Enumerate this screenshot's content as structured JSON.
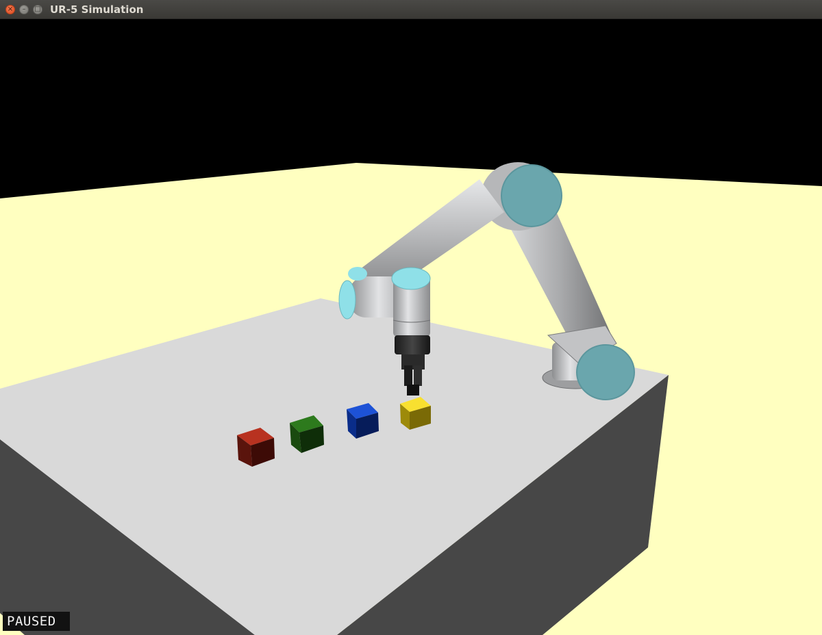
{
  "window": {
    "title": "UR-5 Simulation",
    "buttons": {
      "close": "×",
      "minimize": "–",
      "maximize": "□"
    }
  },
  "viewport": {
    "status_label": "PAUSED"
  },
  "scene": {
    "robot": "UR-5",
    "blocks": [
      {
        "name": "red-block",
        "color": "#8a1e12"
      },
      {
        "name": "green-block",
        "color": "#1c5a12"
      },
      {
        "name": "blue-block",
        "color": "#0a3cb4"
      },
      {
        "name": "yellow-block",
        "color": "#e8cf12"
      }
    ],
    "colors": {
      "floor": "#ffffc0",
      "table_top": "#d9d9d9",
      "table_side": "#474747",
      "joint_cap": "#6aa6ad",
      "link": "#a9aaac"
    }
  }
}
